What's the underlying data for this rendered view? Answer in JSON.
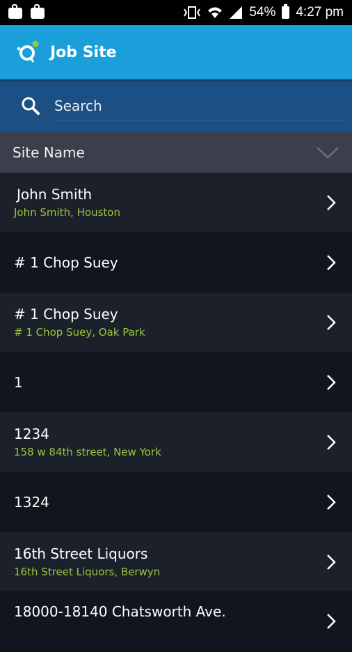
{
  "status_bar": {
    "battery_percent": "54%",
    "time": "4:27 pm"
  },
  "app_bar": {
    "title": "Job Site",
    "logo_icon": "app-logo-icon"
  },
  "search": {
    "placeholder": "Search",
    "icon": "search-icon"
  },
  "sort": {
    "label": "Site Name",
    "icon": "chevron-down-icon"
  },
  "sites": [
    {
      "name": "John Smith",
      "address": "John Smith, Houston"
    },
    {
      "name": "# 1 Chop Suey",
      "address": ""
    },
    {
      "name": "# 1 Chop Suey",
      "address": "# 1 Chop Suey, Oak Park"
    },
    {
      "name": "1",
      "address": ""
    },
    {
      "name": "1234",
      "address": "158 w 84th street, New York"
    },
    {
      "name": "1324",
      "address": ""
    },
    {
      "name": "16th Street Liquors",
      "address": "16th Street Liquors, Berwyn"
    },
    {
      "name": "18000-18140 Chatsworth Ave.",
      "address": ""
    }
  ],
  "colors": {
    "app_bar": "#1a9fdb",
    "search_bar": "#1c4f84",
    "sort_bar": "#3a3f4b",
    "address_text": "#9bc53d"
  }
}
